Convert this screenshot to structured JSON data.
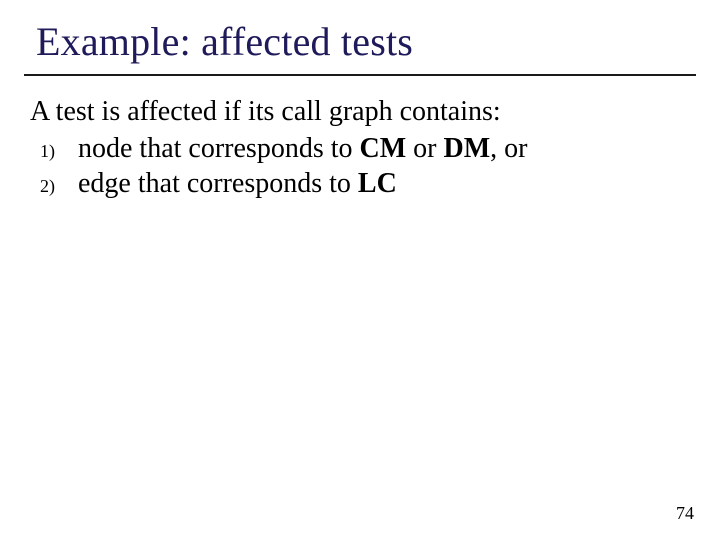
{
  "slide": {
    "title": "Example: affected tests",
    "intro": "A test is affected if its call graph contains:",
    "items": [
      {
        "marker": "1)",
        "pre": "node that corresponds to ",
        "b1": "CM",
        "mid": " or ",
        "b2": "DM",
        "post": ", or"
      },
      {
        "marker": "2)",
        "pre": "edge that corresponds to ",
        "b1": "LC",
        "mid": "",
        "b2": "",
        "post": ""
      }
    ],
    "page_number": "74"
  }
}
